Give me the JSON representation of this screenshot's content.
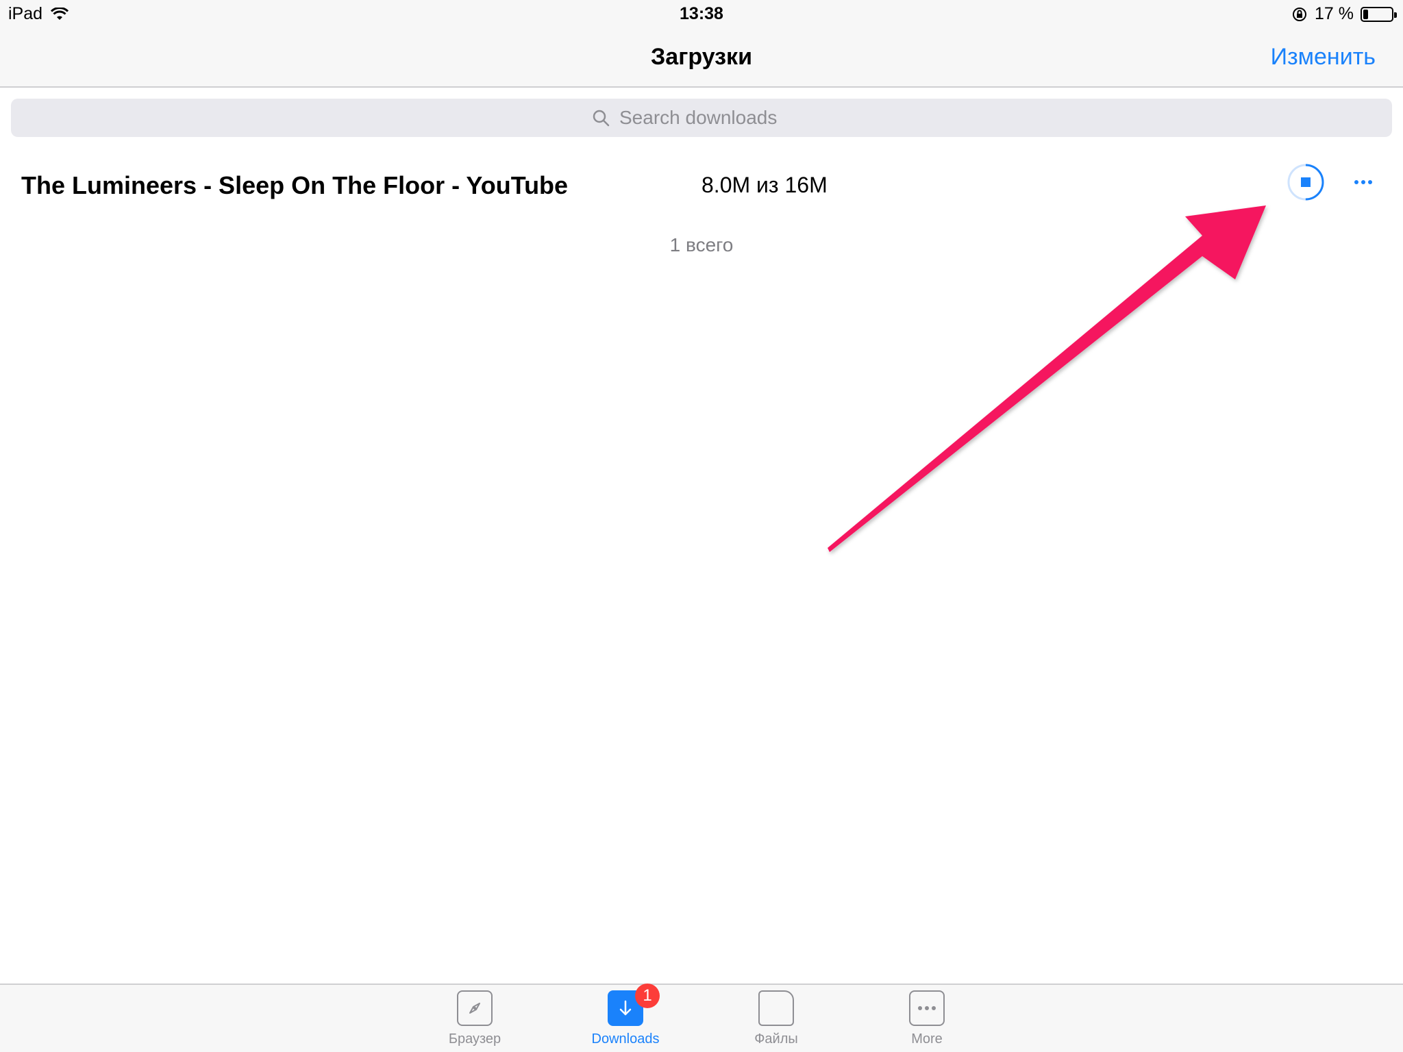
{
  "status_bar": {
    "device": "iPad",
    "time": "13:38",
    "battery": "17 %",
    "battery_level": 0.17
  },
  "nav": {
    "title": "Загрузки",
    "edit_label": "Изменить"
  },
  "search": {
    "placeholder": "Search downloads"
  },
  "downloads": [
    {
      "title": "The Lumineers - Sleep On The Floor - YouTube",
      "size": "8.0M из 16M",
      "progress": 0.5
    }
  ],
  "footer": {
    "total": "1 всего"
  },
  "tabs": [
    {
      "label": "Браузер",
      "icon": "compass-icon"
    },
    {
      "label": "Downloads",
      "icon": "download-arrow-icon",
      "badge": "1"
    },
    {
      "label": "Файлы",
      "icon": "file-icon"
    },
    {
      "label": "More",
      "icon": "more-icon"
    }
  ],
  "colors": {
    "accent": "#1a82fb",
    "badge": "#fc3d39",
    "annotation_arrow": "#f5175f"
  }
}
